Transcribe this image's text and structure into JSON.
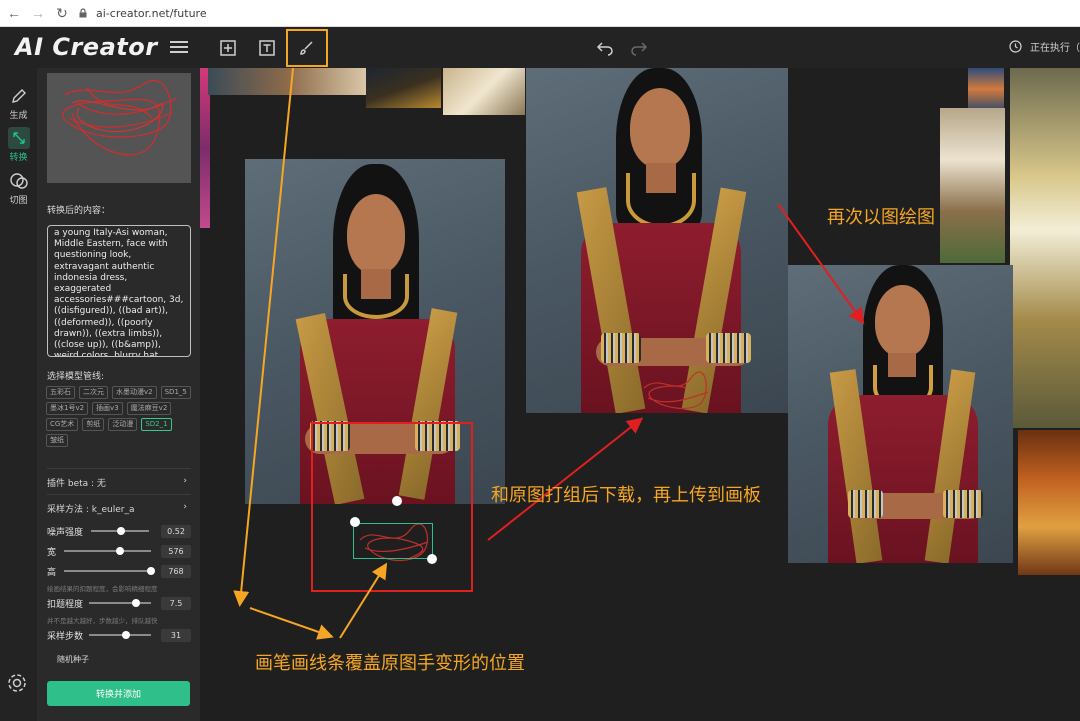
{
  "browser": {
    "url": "ai-creator.net/future"
  },
  "app": {
    "brand": "AI Creator",
    "status": "正在执行（"
  },
  "leftnav": {
    "items": [
      {
        "label": "生成"
      },
      {
        "label": "转换"
      },
      {
        "label": "切图"
      }
    ]
  },
  "panel": {
    "converted_label": "转换后的内容：",
    "prompt_text": "a young Italy-Asi woman, Middle Eastern, face with questioning look, extravagant authentic indonesia dress, exaggerated accessories###cartoon, 3d, ((disfigured)), ((bad art)), ((deformed)), ((poorly drawn)), ((extra limbs)), ((close up)), ((b&amp)), weird colors, blurry,hat",
    "model_label": "选择模型管线:",
    "models": [
      "五彩石",
      "二次元",
      "水墨动漫v2",
      "SD1_5",
      "墨冰1号v2",
      "插画v3",
      "魔法麻豆v2",
      "CG艺术",
      "剪纸",
      "泛动漫",
      "SD2_1",
      "皱纸"
    ],
    "selected_model": "SD2_1",
    "plugin_label": "插件 beta : 无",
    "sampler_label": "采样方法 : k_euler_a",
    "sliders": [
      {
        "label": "噪声强度",
        "value": "0.52",
        "fraction": 0.52
      },
      {
        "label": "宽",
        "value": "576",
        "fraction": 0.64
      },
      {
        "label": "高",
        "value": "768",
        "fraction": 1.0
      }
    ],
    "hint1": "绘画结果的扣题程度，会影响精细程度",
    "guidance": {
      "label": "扣题程度",
      "value": "7.5",
      "fraction": 0.75
    },
    "hint2": "并不是越大越好，步数越少，排队越快",
    "steps": {
      "label": "采样步数",
      "value": "31",
      "fraction": 0.6
    },
    "seed_label": "随机种子",
    "convert_button": "转换并添加"
  },
  "annotations": {
    "redraw": "再次以图绘图",
    "group_download": "和原图打组后下载，再上传到画板",
    "brush_cover": "画笔画线条覆盖原图手变形的位置"
  },
  "colors": {
    "accent_green": "#2fbf8a",
    "annotation_orange": "#f5a623",
    "arrow_red": "#e02020"
  }
}
